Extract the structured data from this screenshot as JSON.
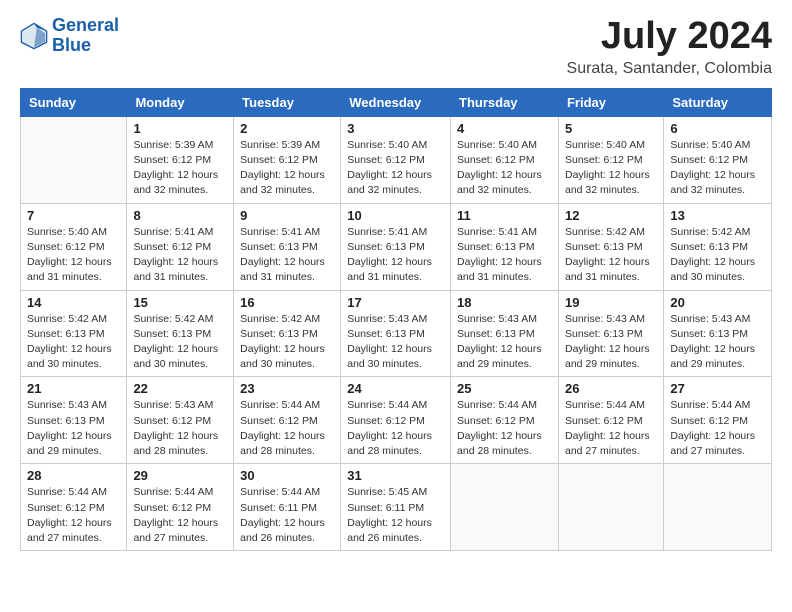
{
  "logo": {
    "text_general": "General",
    "text_blue": "Blue"
  },
  "header": {
    "month_year": "July 2024",
    "location": "Surata, Santander, Colombia"
  },
  "weekdays": [
    "Sunday",
    "Monday",
    "Tuesday",
    "Wednesday",
    "Thursday",
    "Friday",
    "Saturday"
  ],
  "weeks": [
    [
      {
        "day": "",
        "info": ""
      },
      {
        "day": "1",
        "info": "Sunrise: 5:39 AM\nSunset: 6:12 PM\nDaylight: 12 hours\nand 32 minutes."
      },
      {
        "day": "2",
        "info": "Sunrise: 5:39 AM\nSunset: 6:12 PM\nDaylight: 12 hours\nand 32 minutes."
      },
      {
        "day": "3",
        "info": "Sunrise: 5:40 AM\nSunset: 6:12 PM\nDaylight: 12 hours\nand 32 minutes."
      },
      {
        "day": "4",
        "info": "Sunrise: 5:40 AM\nSunset: 6:12 PM\nDaylight: 12 hours\nand 32 minutes."
      },
      {
        "day": "5",
        "info": "Sunrise: 5:40 AM\nSunset: 6:12 PM\nDaylight: 12 hours\nand 32 minutes."
      },
      {
        "day": "6",
        "info": "Sunrise: 5:40 AM\nSunset: 6:12 PM\nDaylight: 12 hours\nand 32 minutes."
      }
    ],
    [
      {
        "day": "7",
        "info": "Sunrise: 5:40 AM\nSunset: 6:12 PM\nDaylight: 12 hours\nand 31 minutes."
      },
      {
        "day": "8",
        "info": "Sunrise: 5:41 AM\nSunset: 6:12 PM\nDaylight: 12 hours\nand 31 minutes."
      },
      {
        "day": "9",
        "info": "Sunrise: 5:41 AM\nSunset: 6:13 PM\nDaylight: 12 hours\nand 31 minutes."
      },
      {
        "day": "10",
        "info": "Sunrise: 5:41 AM\nSunset: 6:13 PM\nDaylight: 12 hours\nand 31 minutes."
      },
      {
        "day": "11",
        "info": "Sunrise: 5:41 AM\nSunset: 6:13 PM\nDaylight: 12 hours\nand 31 minutes."
      },
      {
        "day": "12",
        "info": "Sunrise: 5:42 AM\nSunset: 6:13 PM\nDaylight: 12 hours\nand 31 minutes."
      },
      {
        "day": "13",
        "info": "Sunrise: 5:42 AM\nSunset: 6:13 PM\nDaylight: 12 hours\nand 30 minutes."
      }
    ],
    [
      {
        "day": "14",
        "info": "Sunrise: 5:42 AM\nSunset: 6:13 PM\nDaylight: 12 hours\nand 30 minutes."
      },
      {
        "day": "15",
        "info": "Sunrise: 5:42 AM\nSunset: 6:13 PM\nDaylight: 12 hours\nand 30 minutes."
      },
      {
        "day": "16",
        "info": "Sunrise: 5:42 AM\nSunset: 6:13 PM\nDaylight: 12 hours\nand 30 minutes."
      },
      {
        "day": "17",
        "info": "Sunrise: 5:43 AM\nSunset: 6:13 PM\nDaylight: 12 hours\nand 30 minutes."
      },
      {
        "day": "18",
        "info": "Sunrise: 5:43 AM\nSunset: 6:13 PM\nDaylight: 12 hours\nand 29 minutes."
      },
      {
        "day": "19",
        "info": "Sunrise: 5:43 AM\nSunset: 6:13 PM\nDaylight: 12 hours\nand 29 minutes."
      },
      {
        "day": "20",
        "info": "Sunrise: 5:43 AM\nSunset: 6:13 PM\nDaylight: 12 hours\nand 29 minutes."
      }
    ],
    [
      {
        "day": "21",
        "info": "Sunrise: 5:43 AM\nSunset: 6:13 PM\nDaylight: 12 hours\nand 29 minutes."
      },
      {
        "day": "22",
        "info": "Sunrise: 5:43 AM\nSunset: 6:12 PM\nDaylight: 12 hours\nand 28 minutes."
      },
      {
        "day": "23",
        "info": "Sunrise: 5:44 AM\nSunset: 6:12 PM\nDaylight: 12 hours\nand 28 minutes."
      },
      {
        "day": "24",
        "info": "Sunrise: 5:44 AM\nSunset: 6:12 PM\nDaylight: 12 hours\nand 28 minutes."
      },
      {
        "day": "25",
        "info": "Sunrise: 5:44 AM\nSunset: 6:12 PM\nDaylight: 12 hours\nand 28 minutes."
      },
      {
        "day": "26",
        "info": "Sunrise: 5:44 AM\nSunset: 6:12 PM\nDaylight: 12 hours\nand 27 minutes."
      },
      {
        "day": "27",
        "info": "Sunrise: 5:44 AM\nSunset: 6:12 PM\nDaylight: 12 hours\nand 27 minutes."
      }
    ],
    [
      {
        "day": "28",
        "info": "Sunrise: 5:44 AM\nSunset: 6:12 PM\nDaylight: 12 hours\nand 27 minutes."
      },
      {
        "day": "29",
        "info": "Sunrise: 5:44 AM\nSunset: 6:12 PM\nDaylight: 12 hours\nand 27 minutes."
      },
      {
        "day": "30",
        "info": "Sunrise: 5:44 AM\nSunset: 6:11 PM\nDaylight: 12 hours\nand 26 minutes."
      },
      {
        "day": "31",
        "info": "Sunrise: 5:45 AM\nSunset: 6:11 PM\nDaylight: 12 hours\nand 26 minutes."
      },
      {
        "day": "",
        "info": ""
      },
      {
        "day": "",
        "info": ""
      },
      {
        "day": "",
        "info": ""
      }
    ]
  ]
}
